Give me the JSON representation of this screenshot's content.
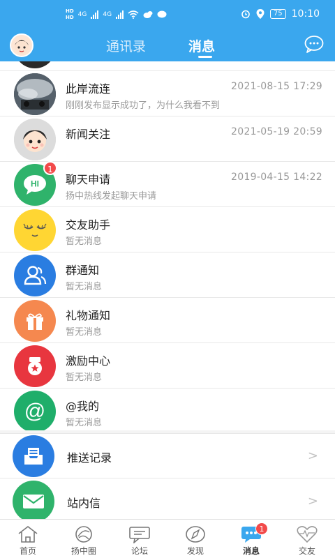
{
  "status_bar": {
    "hd_top": "HD",
    "hd_bottom": "HD",
    "net1": "4G",
    "net2": "4G",
    "battery": "75",
    "time": "10:10"
  },
  "header": {
    "tab_contacts": "通讯录",
    "tab_messages": "消息",
    "chat_icon": "chat-bubble-icon"
  },
  "messages": [
    {
      "title": "此岸流连",
      "time": "2021-08-15 17:29",
      "preview": "刚刚发布显示成功了，为什么我看不到"
    },
    {
      "title": "新闻关注",
      "time": "2021-05-19 20:59",
      "preview": ""
    },
    {
      "title": "聊天申请",
      "time": "2019-04-15 14:22",
      "preview": "扬中热线发起聊天申请",
      "badge": "1"
    },
    {
      "title": "交友助手",
      "time": "",
      "preview": "暂无消息"
    },
    {
      "title": "群通知",
      "time": "",
      "preview": "暂无消息"
    },
    {
      "title": "礼物通知",
      "time": "",
      "preview": "暂无消息"
    },
    {
      "title": "激励中心",
      "time": "",
      "preview": "暂无消息"
    },
    {
      "title": "@我的",
      "time": "",
      "preview": "暂无消息"
    }
  ],
  "nav_items": [
    {
      "title": "推送记录",
      "chevron": ">"
    },
    {
      "title": "站内信",
      "chevron": ">"
    }
  ],
  "icons": {
    "chat_apply_text": "HI",
    "mention_text": "@"
  },
  "tabbar": [
    {
      "label": "首页",
      "icon": "home-icon"
    },
    {
      "label": "扬中圈",
      "icon": "circle-icon"
    },
    {
      "label": "论坛",
      "icon": "forum-icon"
    },
    {
      "label": "发现",
      "icon": "compass-icon"
    },
    {
      "label": "消息",
      "icon": "message-icon",
      "badge": "1",
      "active": true
    },
    {
      "label": "交友",
      "icon": "heart-icon"
    }
  ],
  "colors": {
    "brand": "#3aa7ee",
    "badge": "#f24a4a",
    "chat_apply": "#2fb36b",
    "friend_helper": "#ffd633",
    "group_notice": "#2a7de1",
    "gift": "#f5884f",
    "incentive": "#e8363f",
    "mention": "#1fae6a",
    "push_record": "#2a7de1",
    "inbox": "#2fb36b"
  }
}
